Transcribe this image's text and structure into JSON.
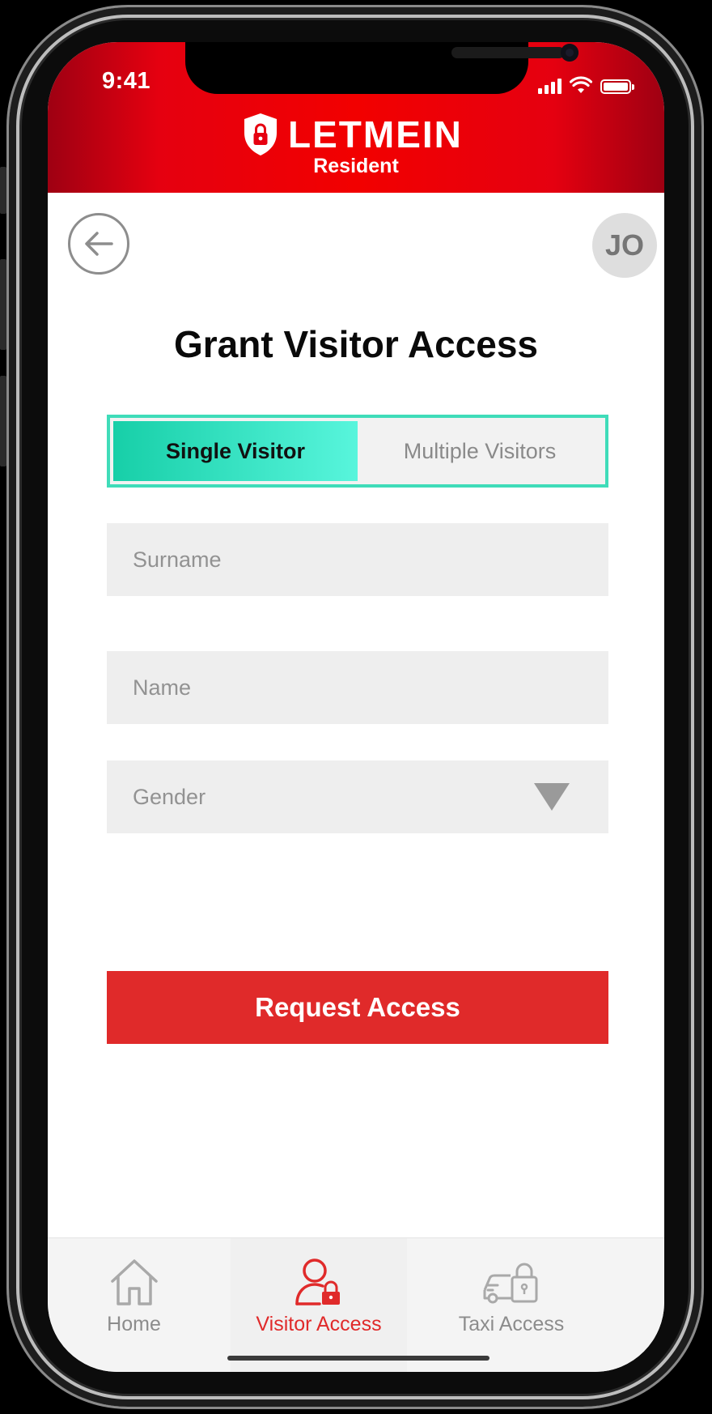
{
  "status_bar": {
    "time": "9:41"
  },
  "header": {
    "brand": "LETMEIN",
    "subtitle": "Resident"
  },
  "nav": {
    "back_icon": "arrow-left-circle",
    "avatar_initials": "JO"
  },
  "page": {
    "title": "Grant Visitor Access"
  },
  "visitor_toggle": {
    "options": [
      "Single Visitor",
      "Multiple Visitors"
    ],
    "selected": "Single Visitor"
  },
  "form": {
    "surname": {
      "placeholder": "Surname",
      "value": ""
    },
    "name": {
      "placeholder": "Name",
      "value": ""
    },
    "gender": {
      "placeholder": "Gender",
      "value": ""
    },
    "submit_label": "Request Access"
  },
  "bottom_nav": {
    "items": [
      {
        "label": "Home",
        "icon": "home-icon",
        "active": false
      },
      {
        "label": "Visitor Access",
        "icon": "person-lock-icon",
        "active": true
      },
      {
        "label": "Taxi Access",
        "icon": "car-lock-icon",
        "active": false
      }
    ]
  },
  "colors": {
    "header_red": "#f20000",
    "accent_teal": "#3fdcb9",
    "cta_red": "#e02a2a",
    "active_nav": "#e02a2a"
  }
}
